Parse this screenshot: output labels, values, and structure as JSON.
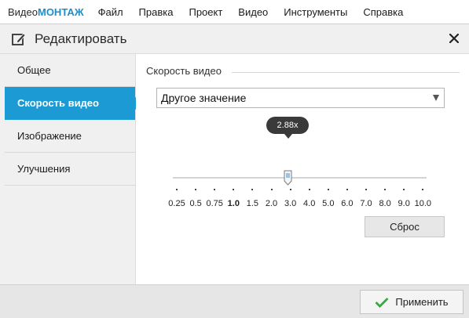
{
  "menubar": {
    "logo_part1": "Видео",
    "logo_part2": "МОНТАЖ",
    "items": [
      "Файл",
      "Правка",
      "Проект",
      "Видео",
      "Инструменты",
      "Справка"
    ]
  },
  "dialog": {
    "title": "Редактировать",
    "title_icon": "edit-icon",
    "close_icon": "close-icon",
    "sidebar": {
      "items": [
        "Общее",
        "Скорость видео",
        "Изображение",
        "Улучшения"
      ],
      "active_index": 1
    },
    "content": {
      "section_title": "Скорость видео",
      "select_value": "Другое значение",
      "slider": {
        "value_label": "2.88x",
        "value": 2.88,
        "tick_labels": [
          "0.25",
          "0.5",
          "0.75",
          "1.0",
          "1.5",
          "2.0",
          "3.0",
          "4.0",
          "5.0",
          "6.0",
          "7.0",
          "8.0",
          "9.0",
          "10.0"
        ],
        "bold_tick": "1.0"
      },
      "reset_label": "Сброс"
    },
    "footer": {
      "apply_label": "Применить",
      "apply_icon": "checkmark-icon"
    }
  },
  "colors": {
    "accent": "#1b9ad4",
    "logo_accent": "#1b8fcb",
    "check_green": "#3aa843"
  }
}
